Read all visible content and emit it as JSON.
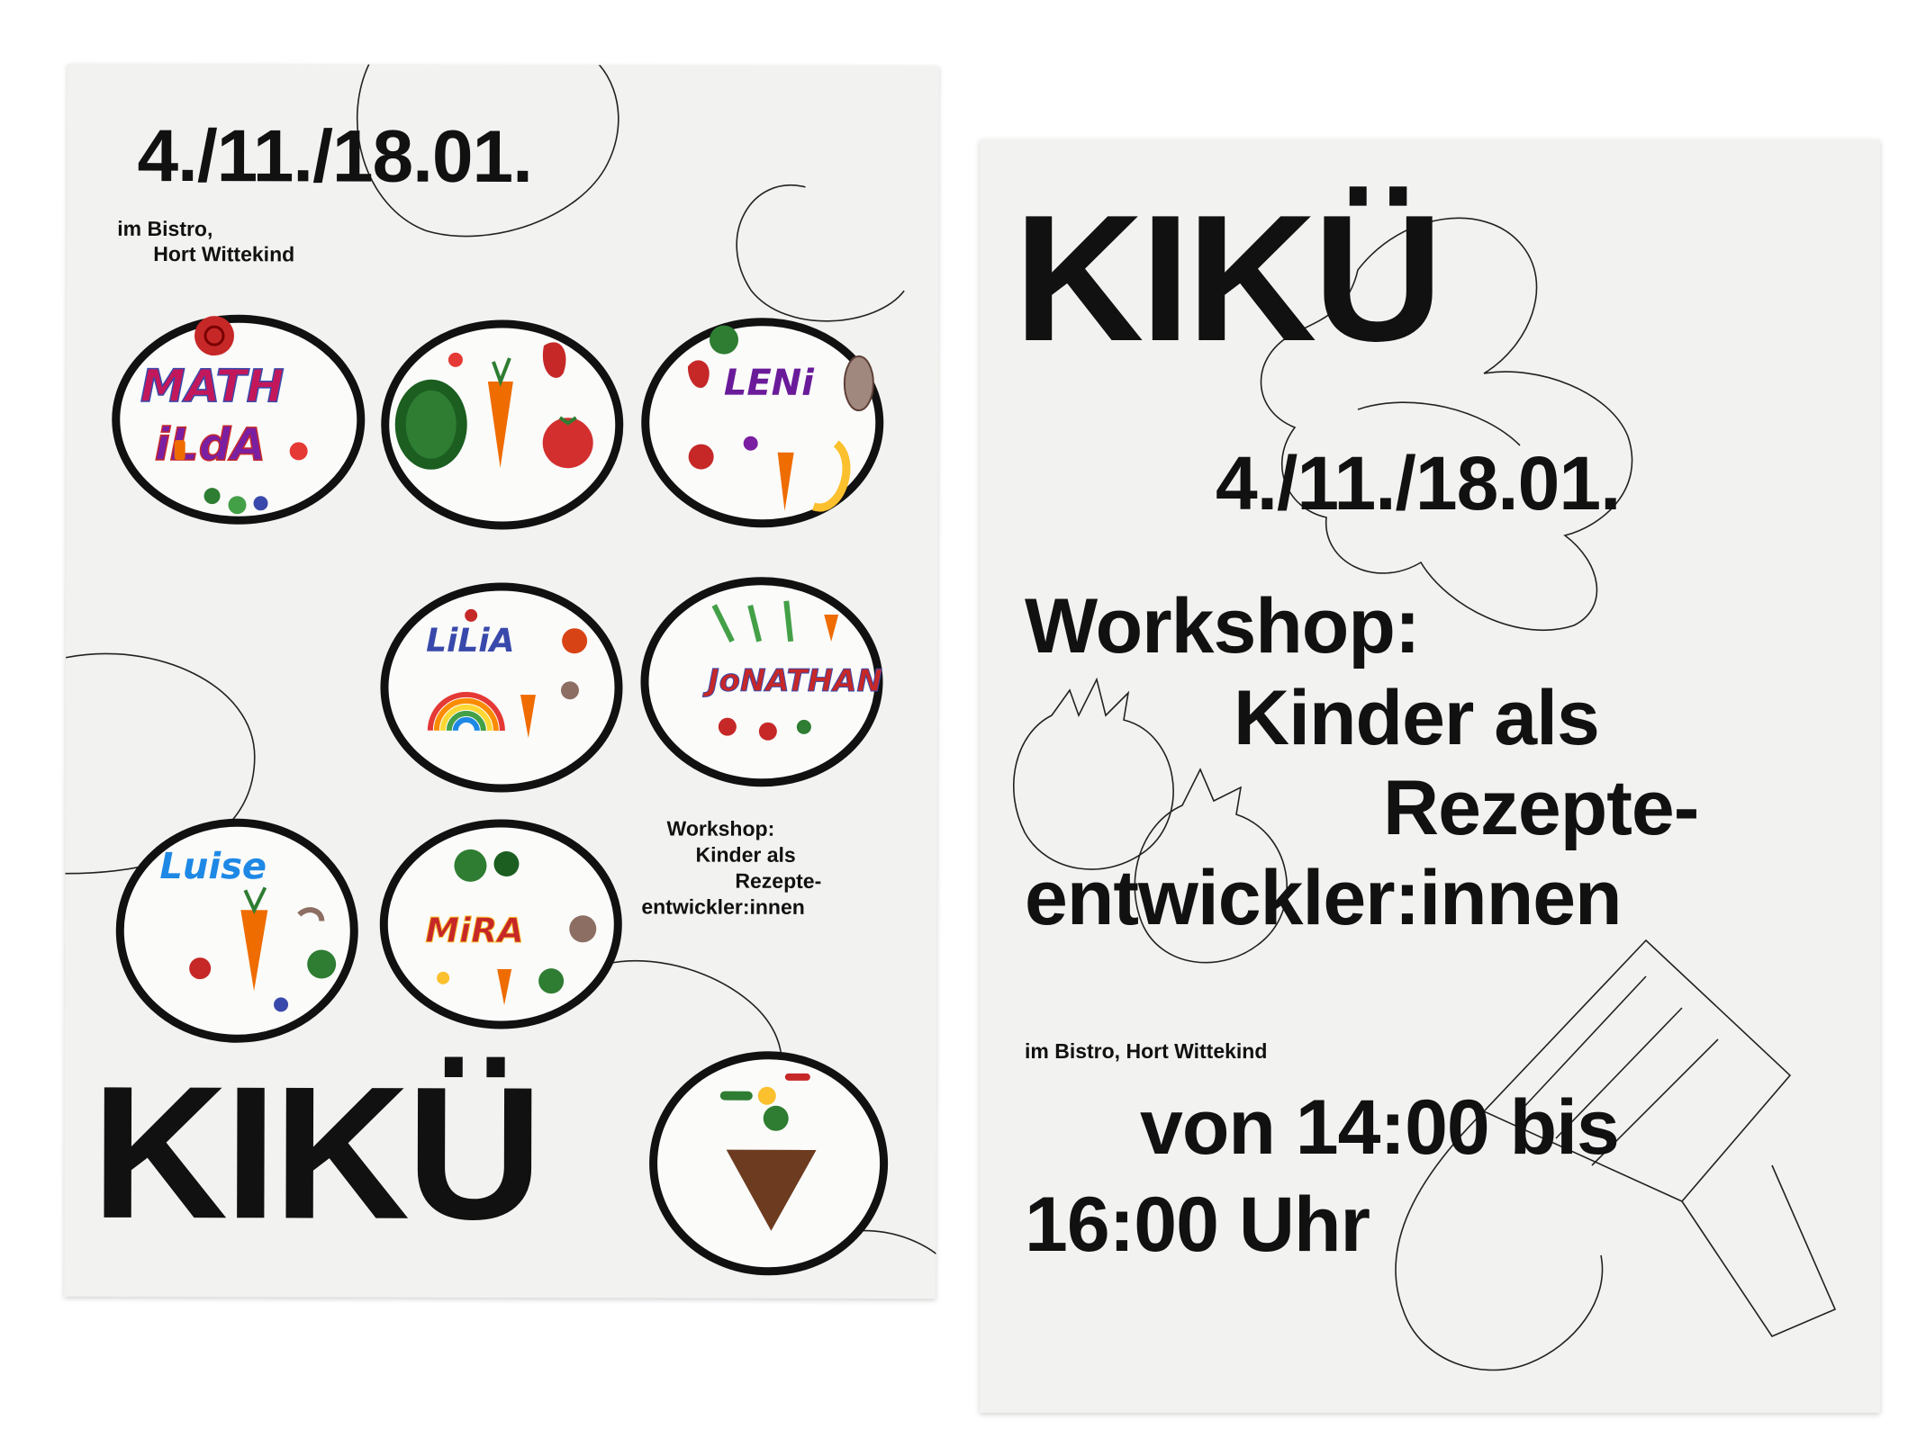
{
  "left_poster": {
    "dates": "4./11./18.01.",
    "location_line1": "im Bistro,",
    "location_line2": "Hort Wittekind",
    "workshop": [
      "Workshop:",
      "Kinder als",
      "Rezepte-",
      "entwickler:innen"
    ],
    "title": "KIKÜ",
    "plates": [
      "MATHILDA",
      "LENI",
      "LILIA",
      "JONATHAN",
      "LUISE",
      "MIRA"
    ],
    "colors": {
      "paper": "#f2f2f0",
      "ink": "#111111"
    }
  },
  "right_poster": {
    "title": "KIKÜ",
    "dates": "4./11./18.01.",
    "workshop": [
      "Workshop:",
      "Kinder als",
      "Rezepte-",
      "entwickler:innen"
    ],
    "location": "im Bistro, Hort Wittekind",
    "time_line1": "von 14:00 bis",
    "time_line2": "16:00 Uhr"
  }
}
